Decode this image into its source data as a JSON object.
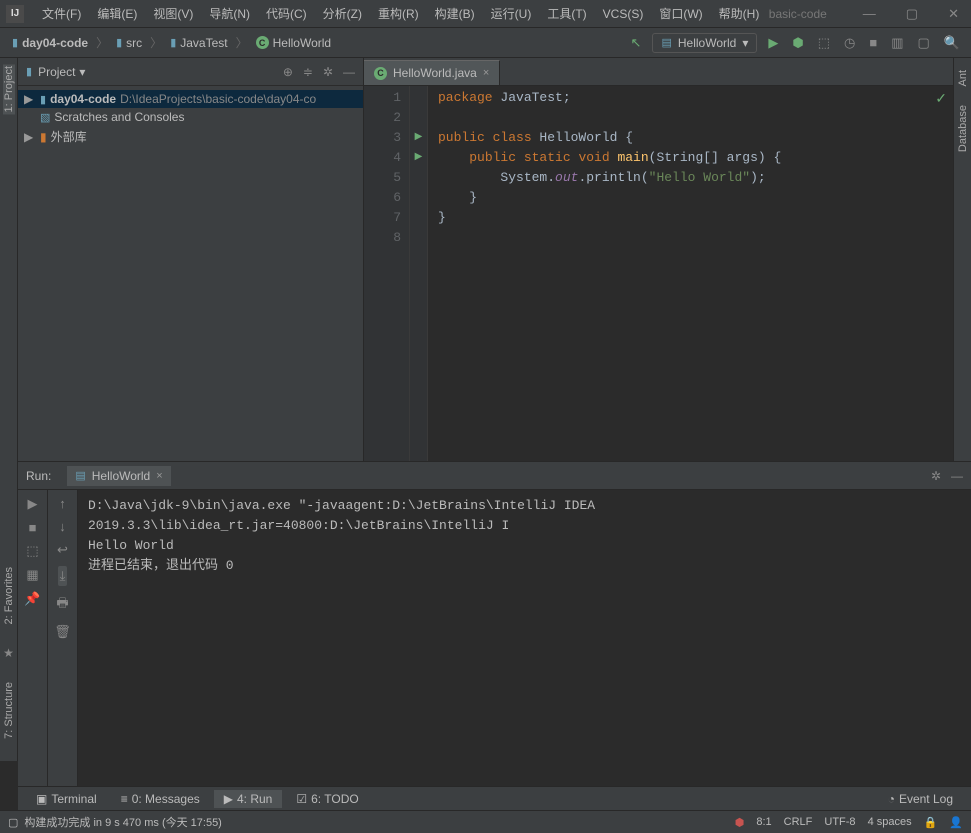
{
  "titlebar": {
    "logo": "IJ",
    "project_name": "basic-code"
  },
  "menu": {
    "file": "文件(F)",
    "edit": "编辑(E)",
    "view": "视图(V)",
    "navigate": "导航(N)",
    "code": "代码(C)",
    "analyze": "分析(Z)",
    "refactor": "重构(R)",
    "build": "构建(B)",
    "run": "运行(U)",
    "tools": "工具(T)",
    "vcs": "VCS(S)",
    "window": "窗口(W)",
    "help": "帮助(H)"
  },
  "breadcrumb": {
    "items": [
      {
        "label": "day04-code",
        "type": "folder"
      },
      {
        "label": "src",
        "type": "folder"
      },
      {
        "label": "JavaTest",
        "type": "folder"
      },
      {
        "label": "HelloWorld",
        "type": "class"
      }
    ]
  },
  "toolbar": {
    "run_config": "HelloWorld"
  },
  "project_panel": {
    "title": "Project",
    "tree": {
      "root_name": "day04-code",
      "root_path": "D:\\IdeaProjects\\basic-code\\day04-co",
      "scratches": "Scratches and Consoles",
      "external_libs": "外部库"
    }
  },
  "left_sidebar": {
    "project": "1: Project"
  },
  "left_sidebar_bottom": {
    "favorites": "2: Favorites",
    "structure": "7: Structure"
  },
  "right_sidebar": {
    "ant": "Ant",
    "database": "Database"
  },
  "editor": {
    "tab_title": "HelloWorld.java",
    "lines": [
      "1",
      "2",
      "3",
      "4",
      "5",
      "6",
      "7",
      "8"
    ],
    "code_tokens": {
      "l1": {
        "kw1": "package",
        "id": " JavaTest;",
        "pad": ""
      },
      "l3": {
        "kw1": "public",
        "kw2": " class",
        "id": " HelloWorld {"
      },
      "l4": {
        "pad": "    ",
        "kw1": "public",
        "kw2": " static",
        "kw3": " void",
        "fn": " main",
        "id": "(String[] args) {"
      },
      "l5": {
        "pad": "        ",
        "id1": "System.",
        "fld": "out",
        "id2": ".println(",
        "str": "\"Hello World\"",
        "id3": ");"
      },
      "l6": {
        "pad": "    ",
        "id": "}"
      },
      "l7": {
        "id": "}"
      }
    }
  },
  "run_panel": {
    "title": "Run:",
    "tab_name": "HelloWorld",
    "output_line1": "D:\\Java\\jdk-9\\bin\\java.exe \"-javaagent:D:\\JetBrains\\IntelliJ IDEA 2019.3.3\\lib\\idea_rt.jar=40800:D:\\JetBrains\\IntelliJ I",
    "output_line2": "Hello World",
    "output_line3": "",
    "output_line4": "进程已结束，退出代码 0"
  },
  "bottom_tabs": {
    "terminal": "Terminal",
    "messages": "0: Messages",
    "run": "4: Run",
    "todo": "6: TODO",
    "event_log": "Event Log"
  },
  "statusbar": {
    "build_msg": "构建成功完成 in 9 s 470 ms (今天 17:55)",
    "line_col": "8:1",
    "line_sep": "CRLF",
    "encoding": "UTF-8",
    "indent": "4 spaces"
  }
}
